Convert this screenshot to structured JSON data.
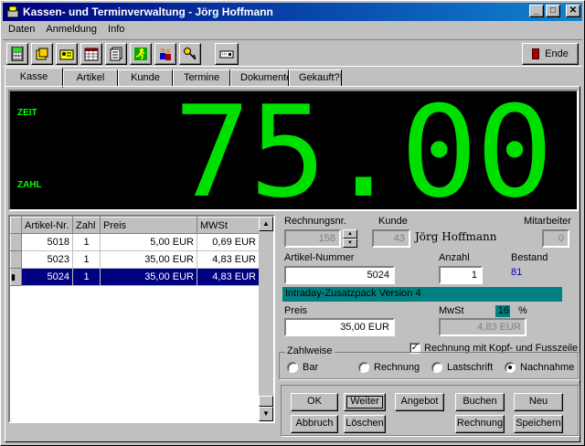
{
  "window": {
    "title": "Kassen- und Terminverwaltung  - Jörg Hoffmann",
    "minimize": "_",
    "maximize": "□",
    "close": "✕"
  },
  "menu": [
    "Daten",
    "Anmeldung",
    "Info"
  ],
  "toolbar": {
    "ende_label": "Ende"
  },
  "tabs": [
    "Kasse",
    "Artikel",
    "Kunde",
    "Termine",
    "Dokumente",
    "Gekauft?!"
  ],
  "display": {
    "zeit_label": "ZEIT",
    "zahl_label": "ZAHL",
    "amount": "75.00"
  },
  "grid": {
    "columns": [
      "Artikel-Nr.",
      "Zahl",
      "Preis",
      "MWSt"
    ],
    "rows": [
      {
        "nr": "5018",
        "zahl": "1",
        "preis": "5,00 EUR",
        "mwst": "0,69 EUR"
      },
      {
        "nr": "5023",
        "zahl": "1",
        "preis": "35,00 EUR",
        "mwst": "4,83 EUR"
      },
      {
        "nr": "5024",
        "zahl": "1",
        "preis": "35,00 EUR",
        "mwst": "4,83 EUR"
      }
    ]
  },
  "form": {
    "rechnungsnr_label": "Rechnungsnr.",
    "rechnungsnr_value": "158",
    "kunde_label": "Kunde",
    "kunde_value": "43",
    "kunde_name": "Jörg Hoffmann",
    "mitarbeiter_label": "Mitarbeiter",
    "mitarbeiter_value": "0",
    "artikelnummer_label": "Artikel-Nummer",
    "artikelnummer_value": "5024",
    "anzahl_label": "Anzahl",
    "anzahl_value": "1",
    "bestand_label": "Bestand",
    "bestand_value": "81",
    "article_description": "Intraday-Zusatzpack Version 4",
    "preis_label": "Preis",
    "preis_value": "35,00 EUR",
    "mwst_label": "MwSt",
    "mwst_rate": "16",
    "mwst_percent": "%",
    "mwst_value": "4,83 EUR",
    "rechnung_kopf_label": "Rechnung mit Kopf- und Fusszeile",
    "rechnung_kopf_checked": "✓"
  },
  "zahlweise": {
    "label": "Zahlweise",
    "options": [
      "Bar",
      "Rechnung",
      "Lastschrift",
      "Nachnahme"
    ],
    "selected": "Nachnahme"
  },
  "buttons": {
    "ok": "OK",
    "weiter": "Weiter",
    "angebot": "Angebot",
    "buchen": "Buchen",
    "neu": "Neu",
    "abbruch": "Abbruch",
    "loeschen": "Löschen",
    "rechnung": "Rechnung",
    "speichern": "Speichern"
  },
  "colors": {
    "titlebar": "#000080",
    "display_green": "#00e000",
    "selection": "#000080",
    "info_teal": "#008080",
    "bestand_blue": "#0000c0"
  }
}
